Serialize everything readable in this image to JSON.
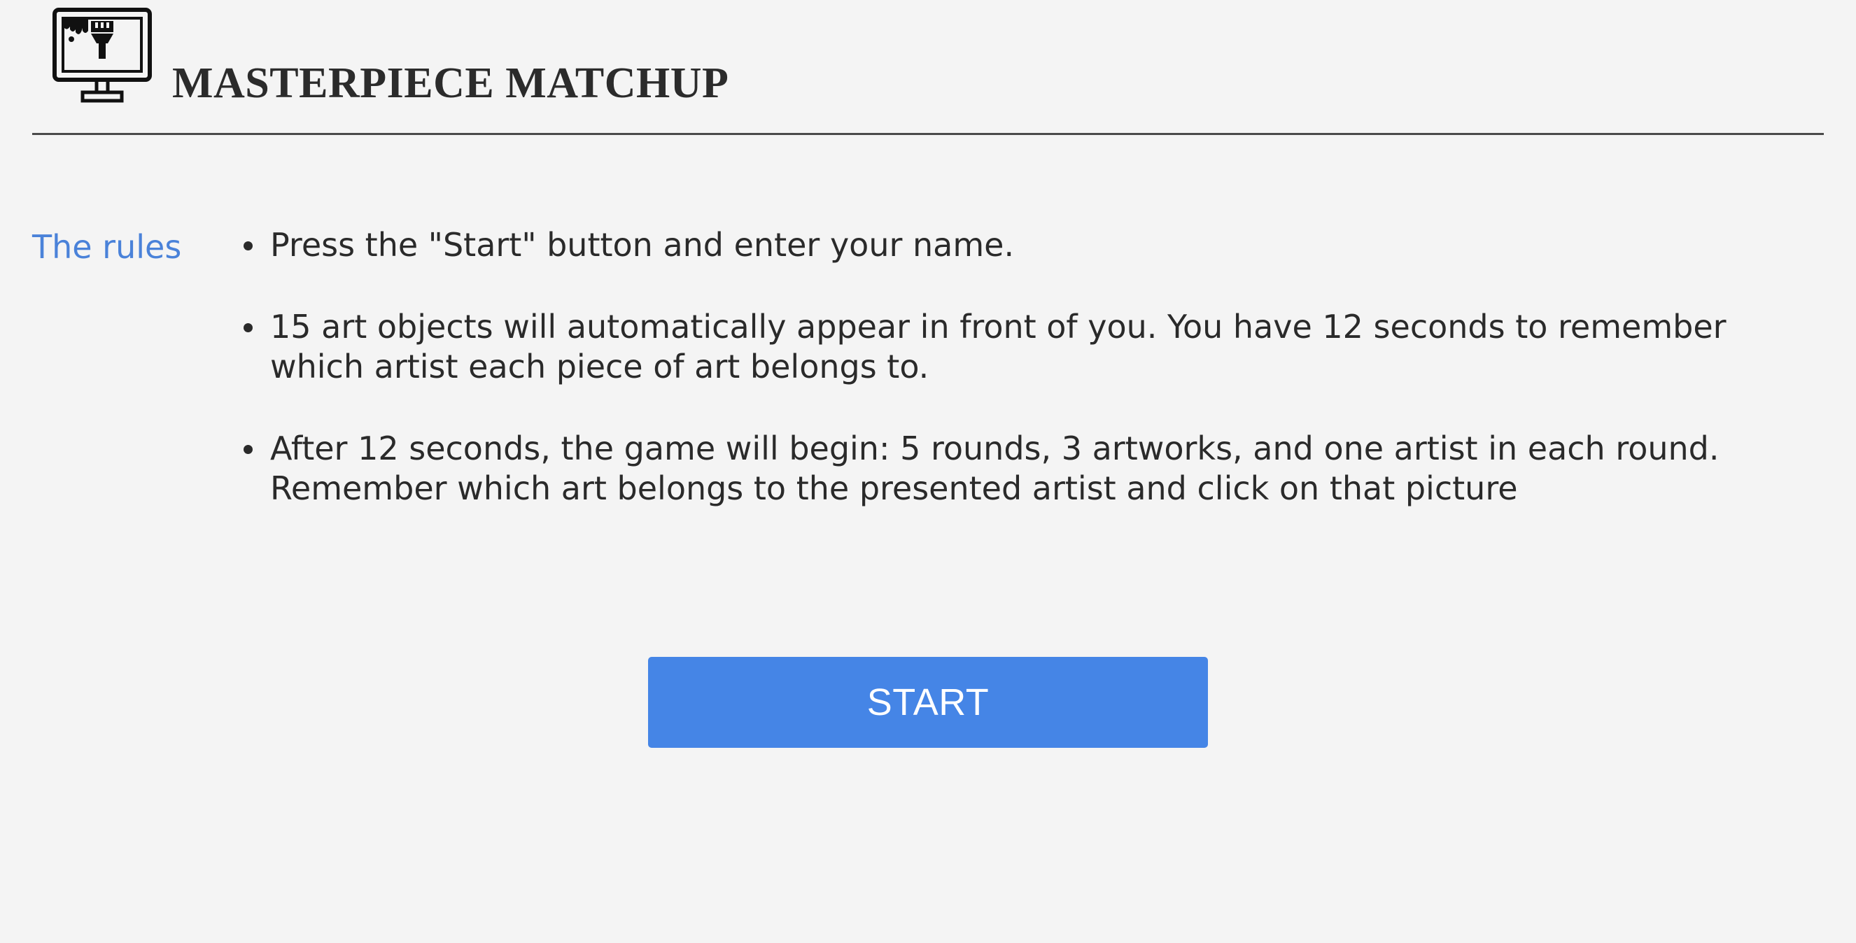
{
  "header": {
    "logo_icon": "monitor-paintbrush-icon",
    "title": "MASTERPIECE MATCHUP"
  },
  "rules": {
    "label": "The rules",
    "items": [
      "Press the \"Start\" button and enter your name.",
      "15 art objects will automatically appear in front of you. You have 12 seconds to remember which artist each piece of art belongs to.",
      "After 12 seconds, the game will begin: 5 rounds, 3 artworks, and one artist in each round. Remember which art belongs to the presented artist and click on that picture"
    ]
  },
  "start_button": {
    "label": "START"
  },
  "colors": {
    "background": "#f4f4f4",
    "accent": "#4585e6",
    "rules_label": "#4a82d9",
    "text": "#2a2a2a"
  }
}
